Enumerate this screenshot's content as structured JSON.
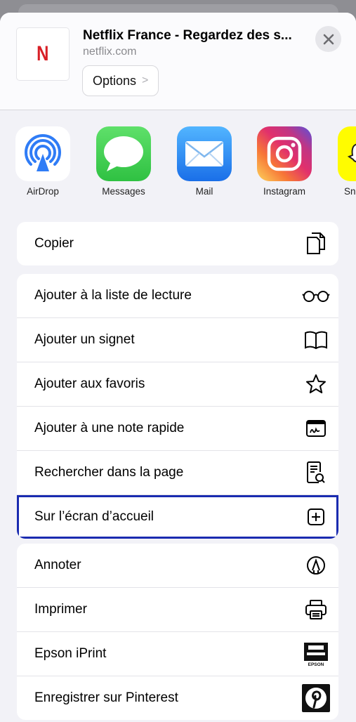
{
  "header": {
    "thumbnail_letter": "N",
    "title": "Netflix France - Regardez des s...",
    "domain": "netflix.com",
    "options_label": "Options",
    "options_chevron": ">",
    "close_icon": "close-icon"
  },
  "apps": [
    {
      "label": "AirDrop",
      "icon": "airdrop-icon"
    },
    {
      "label": "Messages",
      "icon": "messages-icon"
    },
    {
      "label": "Mail",
      "icon": "mail-icon"
    },
    {
      "label": "Instagram",
      "icon": "instagram-icon"
    },
    {
      "label": "Sn",
      "icon": "snapchat-icon"
    }
  ],
  "groups": [
    {
      "items": [
        {
          "label": "Copier",
          "icon": "copy-icon"
        }
      ]
    },
    {
      "items": [
        {
          "label": "Ajouter à la liste de lecture",
          "icon": "glasses-icon"
        },
        {
          "label": "Ajouter un signet",
          "icon": "book-icon"
        },
        {
          "label": "Ajouter aux favoris",
          "icon": "star-icon"
        },
        {
          "label": "Ajouter à une note rapide",
          "icon": "quick-note-icon"
        },
        {
          "label": "Rechercher dans la page",
          "icon": "find-in-page-icon"
        },
        {
          "label": "Sur l’écran d’accueil",
          "icon": "add-square-icon",
          "highlighted": true
        }
      ]
    },
    {
      "items": [
        {
          "label": "Annoter",
          "icon": "markup-pen-icon"
        },
        {
          "label": "Imprimer",
          "icon": "printer-icon"
        },
        {
          "label": "Epson iPrint",
          "icon": "epson-icon",
          "icon_text": "EPSON"
        },
        {
          "label": "Enregistrer sur Pinterest",
          "icon": "pinterest-icon"
        }
      ]
    }
  ],
  "colors": {
    "highlight_border": "#1a2bb0",
    "netflix_red": "#d81f26",
    "airdrop_blue": "#2f7cf6",
    "messages_green": "#34c759",
    "mail_blue": "#2d8cf0"
  }
}
